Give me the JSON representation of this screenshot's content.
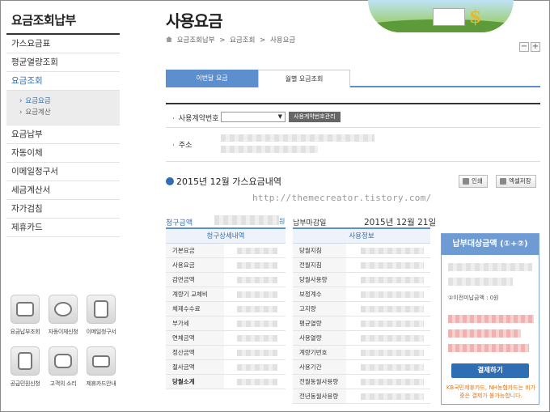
{
  "sidebar": {
    "title": "요금조회납부",
    "items": [
      "가스요금표",
      "평균열량조회",
      "요금조회",
      "요금납부",
      "자동이체",
      "이메일청구서",
      "세금계산서",
      "자가검침",
      "제휴카드"
    ],
    "sub": [
      "요금요금",
      "요금계산"
    ],
    "sub_arrow": "›"
  },
  "quick": [
    "요금납부조회",
    "자동이체신청",
    "이메일청구서",
    "공급민원신청",
    "고객의 소리",
    "제휴카드안내"
  ],
  "header": {
    "title": "사용요금",
    "breadcrumb": [
      "요금조회납부",
      ">",
      "요금조회",
      ">",
      "사용요금"
    ],
    "zoom_minus": "−",
    "zoom_plus": "+"
  },
  "tabs": [
    "이번달 요금",
    "월별 요금조회"
  ],
  "info": {
    "contract_label": "사용계약번호",
    "contract_select": "▼",
    "manage_button": "사용계약번호관리",
    "address_label": "주소"
  },
  "section": {
    "title": "2015년  12월  가스요금내역",
    "print": "인쇄",
    "excel": "엑셀저장",
    "watermark": "http://themecreator.tistory.com/"
  },
  "summary": {
    "billed_label": "청구금액",
    "billed_unit": "원",
    "due_label": "납부마감일",
    "due_value": "2015년  12월  21일"
  },
  "detail": {
    "head": "청구상세내역",
    "rows": [
      "기본요금",
      "사용요금",
      "감면금액",
      "계량기 교체비",
      "체제수수료",
      "부가세",
      "연체금액",
      "정산금액",
      "절사금액",
      "당월소계"
    ]
  },
  "usage": {
    "head": "사용정보",
    "rows": [
      "당월지침",
      "전월지침",
      "당월사용량",
      "보정계수",
      "고지량",
      "평균열량",
      "사용열량",
      "계량기번호",
      "사용기간",
      "전월동월사용량",
      "전년동월사용량"
    ]
  },
  "payment": {
    "head": "납부대상금액 (①+②)",
    "note": "②이전미납금액 : 0원",
    "button": "결제하기",
    "warning": "KB국민제휴카드, NH농협카드는 비가중은 결제가 불가능합니다."
  },
  "colors": {
    "accent": "#2f6db5",
    "tab": "#5d8fcf",
    "warn": "#e07a1f"
  }
}
